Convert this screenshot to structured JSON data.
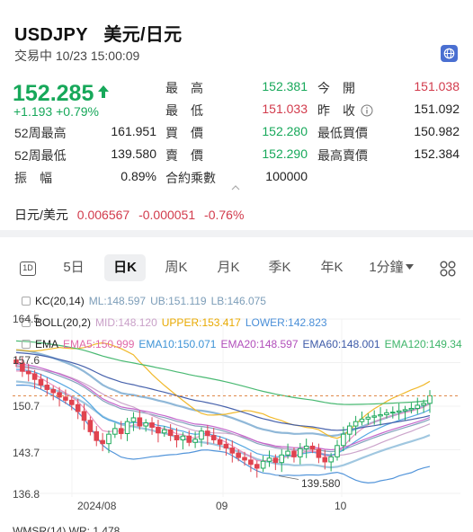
{
  "header": {
    "symbol": "USDJPY",
    "name": "美元/日元",
    "status": "交易中",
    "datetime": "10/23 15:00:09"
  },
  "quote": {
    "price": "152.285",
    "change": "+1.193",
    "change_pct": "+0.79%",
    "rows": [
      {
        "l1": "",
        "v1": "",
        "l2": "最　高",
        "v2": "152.381",
        "l3": "今　開",
        "v3": "151.038"
      },
      {
        "l1": "",
        "v1": "",
        "l2": "最　低",
        "v2": "151.033",
        "l3": "昨　收",
        "v3": "151.092"
      },
      {
        "l1": "52周最高",
        "v1": "161.951",
        "l2": "買　價",
        "v2": "152.280",
        "l3": "最低買價",
        "v3": "150.982"
      },
      {
        "l1": "52周最低",
        "v1": "139.580",
        "l2": "賣　價",
        "v2": "152.290",
        "l3": "最高賣價",
        "v3": "152.384"
      },
      {
        "l1": "振　幅",
        "v1": "0.89%",
        "l2": "合約乘數",
        "v2": "100000",
        "l3": "",
        "v3": ""
      }
    ]
  },
  "cross": {
    "label": "日元/美元",
    "price": "0.006567",
    "change": "-0.000051",
    "change_pct": "-0.76%"
  },
  "tabs": {
    "items": [
      "5日",
      "日K",
      "周K",
      "月K",
      "季K",
      "年K",
      "1分鐘"
    ],
    "active": "日K"
  },
  "indicators": {
    "kc": {
      "name": "KC(20,14)",
      "ml": "ML:148.597",
      "ub": "UB:151.119",
      "lb": "LB:146.075"
    },
    "boll": {
      "name": "BOLL(20,2)",
      "mid": "MID:148.120",
      "upper": "UPPER:153.417",
      "lower": "LOWER:142.823"
    },
    "ema": {
      "name": "EMA",
      "e5": "EMA5:150.999",
      "e10": "EMA10:150.071",
      "e20": "EMA20:148.597",
      "e60": "EMA60:148.001",
      "e120": "EMA120:149.34"
    },
    "wmsr": "WMSR(14)  WR: 1.478"
  },
  "chart_data": {
    "type": "candlestick",
    "y_ticks": [
      "164.5",
      "157.6",
      "150.7",
      "143.7",
      "136.8"
    ],
    "x_ticks": [
      "2024/08",
      "09",
      "10"
    ],
    "ylim": [
      136.8,
      164.5
    ],
    "annotation_low": "139.580",
    "last_price": 152.285,
    "closes": [
      157.5,
      156.2,
      155.8,
      154.9,
      154.0,
      153.3,
      152.8,
      152.1,
      151.6,
      150.9,
      149.8,
      148.4,
      146.6,
      145.2,
      144.7,
      146.2,
      147.1,
      146.3,
      148.2,
      148.8,
      147.5,
      148.0,
      147.3,
      146.4,
      146.9,
      146.0,
      145.3,
      145.9,
      144.9,
      145.4,
      146.7,
      146.0,
      145.3,
      144.6,
      144.0,
      143.2,
      142.5,
      142.1,
      141.4,
      140.8,
      141.9,
      142.4,
      141.7,
      142.9,
      143.5,
      142.6,
      143.9,
      144.3,
      143.8,
      142.5,
      141.8,
      142.6,
      144.4,
      146.2,
      147.5,
      148.2,
      148.6,
      148.9,
      149.1,
      149.3,
      149.6,
      149.7,
      149.9,
      150.1,
      150.3,
      150.8,
      151.1,
      152.3
    ],
    "series": [
      {
        "name": "UB",
        "color": "#8ab4d6"
      },
      {
        "name": "ML",
        "color": "#7c9db8"
      },
      {
        "name": "LB",
        "color": "#9bc4de"
      },
      {
        "name": "MID",
        "color": "#c9a0c8"
      },
      {
        "name": "UPPER",
        "color": "#f0b521"
      },
      {
        "name": "LOWER",
        "color": "#4a8fd8"
      },
      {
        "name": "EMA5",
        "color": "#e88fc0"
      },
      {
        "name": "EMA10",
        "color": "#4da3e0"
      },
      {
        "name": "EMA20",
        "color": "#c15ec9"
      },
      {
        "name": "EMA60",
        "color": "#3d5aa8"
      },
      {
        "name": "EMA120",
        "color": "#3fb56a"
      }
    ]
  }
}
